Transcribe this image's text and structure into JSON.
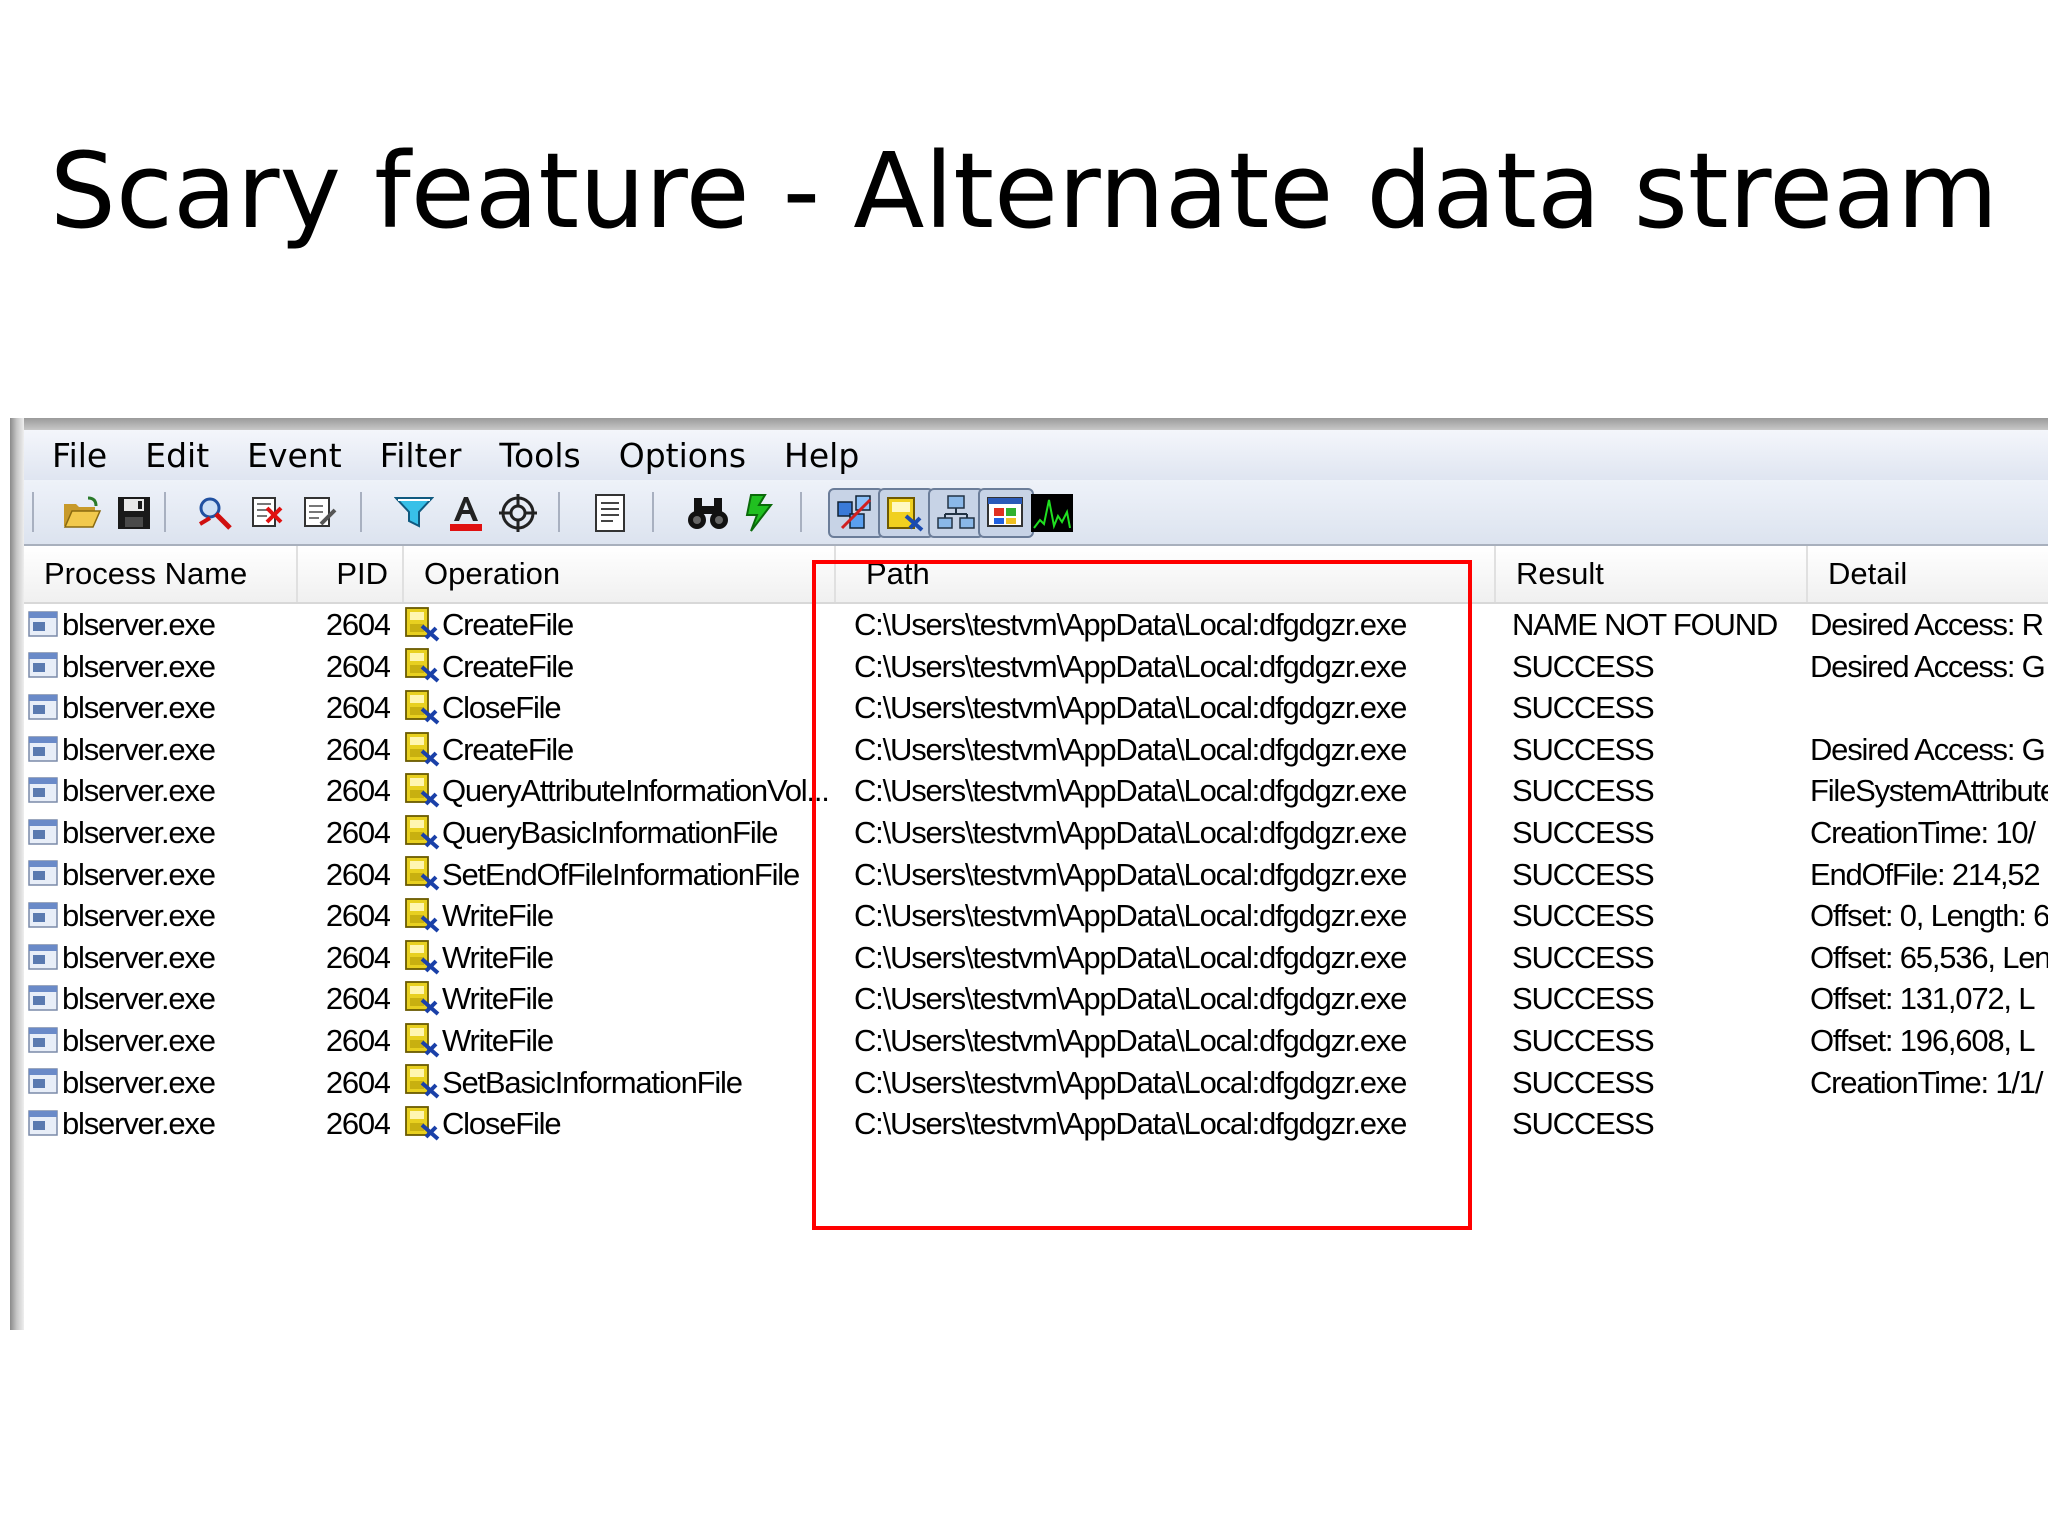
{
  "slide": {
    "title": "Scary feature - Alternate data stream"
  },
  "menu": [
    "File",
    "Edit",
    "Event",
    "Filter",
    "Tools",
    "Options",
    "Help"
  ],
  "toolbar_icons": [
    "open-icon",
    "save-icon",
    "magnify-icon",
    "clear-icon",
    "filter-edit-icon",
    "filter-icon",
    "highlight-icon",
    "target-icon",
    "properties-icon",
    "find-icon",
    "jump-icon",
    "registry-activity-icon",
    "file-activity-icon",
    "network-activity-icon",
    "process-activity-icon",
    "profiling-icon"
  ],
  "columns": [
    "Process Name",
    "PID",
    "Operation",
    "Path",
    "Result",
    "Detail"
  ],
  "rows": [
    {
      "process": "blserver.exe",
      "pid": "2604",
      "operation": "CreateFile",
      "path": "C:\\Users\\testvm\\AppData\\Local:dfgdgzr.exe",
      "result": "NAME NOT FOUND",
      "detail": "Desired Access: R"
    },
    {
      "process": "blserver.exe",
      "pid": "2604",
      "operation": "CreateFile",
      "path": "C:\\Users\\testvm\\AppData\\Local:dfgdgzr.exe",
      "result": "SUCCESS",
      "detail": "Desired Access: G"
    },
    {
      "process": "blserver.exe",
      "pid": "2604",
      "operation": "CloseFile",
      "path": "C:\\Users\\testvm\\AppData\\Local:dfgdgzr.exe",
      "result": "SUCCESS",
      "detail": ""
    },
    {
      "process": "blserver.exe",
      "pid": "2604",
      "operation": "CreateFile",
      "path": "C:\\Users\\testvm\\AppData\\Local:dfgdgzr.exe",
      "result": "SUCCESS",
      "detail": "Desired Access: G"
    },
    {
      "process": "blserver.exe",
      "pid": "2604",
      "operation": "QueryAttributeInformationVol...",
      "path": "C:\\Users\\testvm\\AppData\\Local:dfgdgzr.exe",
      "result": "SUCCESS",
      "detail": "FileSystemAttribute"
    },
    {
      "process": "blserver.exe",
      "pid": "2604",
      "operation": "QueryBasicInformationFile",
      "path": "C:\\Users\\testvm\\AppData\\Local:dfgdgzr.exe",
      "result": "SUCCESS",
      "detail": "CreationTime: 10/"
    },
    {
      "process": "blserver.exe",
      "pid": "2604",
      "operation": "SetEndOfFileInformationFile",
      "path": "C:\\Users\\testvm\\AppData\\Local:dfgdgzr.exe",
      "result": "SUCCESS",
      "detail": "EndOfFile: 214,52"
    },
    {
      "process": "blserver.exe",
      "pid": "2604",
      "operation": "WriteFile",
      "path": "C:\\Users\\testvm\\AppData\\Local:dfgdgzr.exe",
      "result": "SUCCESS",
      "detail": "Offset: 0, Length: 6"
    },
    {
      "process": "blserver.exe",
      "pid": "2604",
      "operation": "WriteFile",
      "path": "C:\\Users\\testvm\\AppData\\Local:dfgdgzr.exe",
      "result": "SUCCESS",
      "detail": "Offset: 65,536, Len"
    },
    {
      "process": "blserver.exe",
      "pid": "2604",
      "operation": "WriteFile",
      "path": "C:\\Users\\testvm\\AppData\\Local:dfgdgzr.exe",
      "result": "SUCCESS",
      "detail": "Offset: 131,072, L"
    },
    {
      "process": "blserver.exe",
      "pid": "2604",
      "operation": "WriteFile",
      "path": "C:\\Users\\testvm\\AppData\\Local:dfgdgzr.exe",
      "result": "SUCCESS",
      "detail": "Offset: 196,608, L"
    },
    {
      "process": "blserver.exe",
      "pid": "2604",
      "operation": "SetBasicInformationFile",
      "path": "C:\\Users\\testvm\\AppData\\Local:dfgdgzr.exe",
      "result": "SUCCESS",
      "detail": "CreationTime: 1/1/"
    },
    {
      "process": "blserver.exe",
      "pid": "2604",
      "operation": "CloseFile",
      "path": "C:\\Users\\testvm\\AppData\\Local:dfgdgzr.exe",
      "result": "SUCCESS",
      "detail": ""
    }
  ],
  "colors": {
    "highlight_box": "#ff0000",
    "menubar": "#dfe5f1"
  }
}
